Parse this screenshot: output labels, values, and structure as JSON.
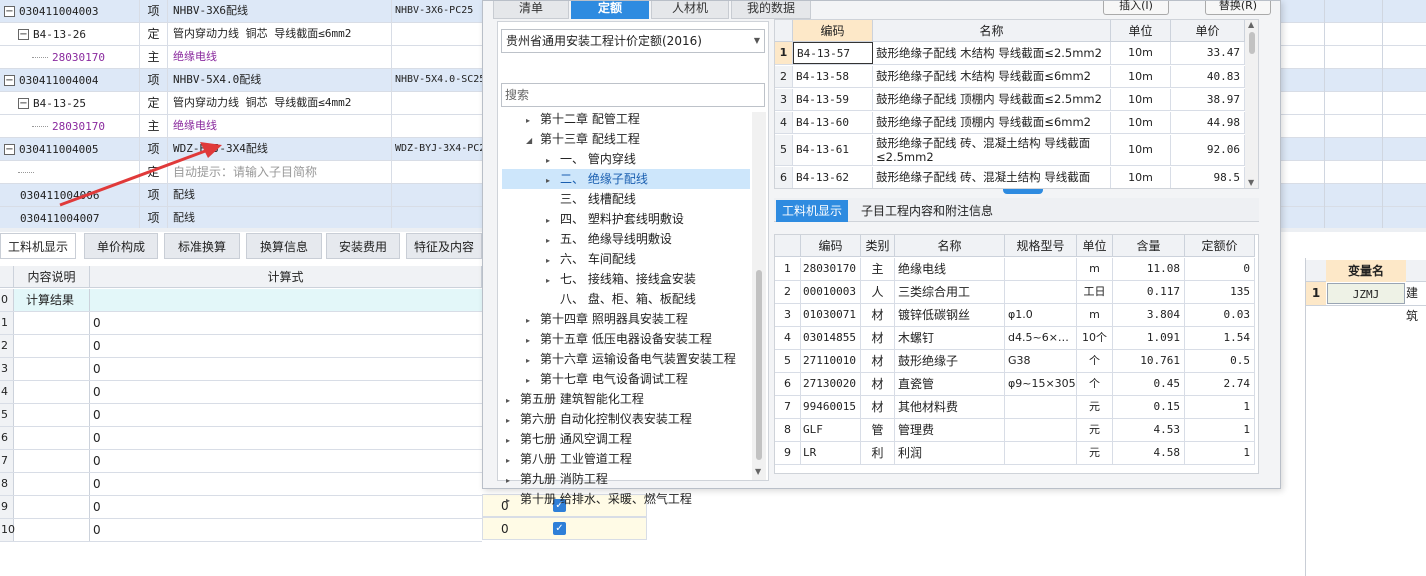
{
  "project_rows": [
    {
      "code": "030411004003",
      "type": "项",
      "name": "NHBV-3X6配线",
      "spec": "NHBV-3X6-PC25",
      "level": 0,
      "highlight": true,
      "tree": "⊟"
    },
    {
      "code": "B4-13-26",
      "type": "定",
      "name": "管内穿动力线 铜芯 导线截面≤6mm2",
      "spec": "",
      "level": 1,
      "highlight": false,
      "tree": "⊟"
    },
    {
      "code": "28030170",
      "type": "主",
      "name": "绝缘电线",
      "spec": "",
      "level": 2,
      "highlight": false,
      "tree": "",
      "purple": true
    },
    {
      "code": "030411004004",
      "type": "项",
      "name": "NHBV-5X4.0配线",
      "spec": "NHBV-5X4.0-SC25",
      "level": 0,
      "highlight": true,
      "tree": "⊟"
    },
    {
      "code": "B4-13-25",
      "type": "定",
      "name": "管内穿动力线 铜芯 导线截面≤4mm2",
      "spec": "",
      "level": 1,
      "highlight": false,
      "tree": "⊟"
    },
    {
      "code": "28030170",
      "type": "主",
      "name": "绝缘电线",
      "spec": "",
      "level": 2,
      "highlight": false,
      "tree": "",
      "purple": true
    },
    {
      "code": "030411004005",
      "type": "项",
      "name": "WDZ-BYJ-3X4配线",
      "spec": "WDZ-BYJ-3X4-PC2",
      "level": 0,
      "highlight": true,
      "tree": "⊟"
    },
    {
      "code": "",
      "type": "定",
      "name": "自动提示：请输入子目简称",
      "spec": "",
      "level": 1,
      "highlight": false,
      "tree": "",
      "gray": true
    },
    {
      "code": "030411004006",
      "type": "项",
      "name": "配线",
      "spec": "",
      "level": 0,
      "highlight": true,
      "tree": ""
    },
    {
      "code": "030411004007",
      "type": "项",
      "name": "配线",
      "spec": "",
      "level": 0,
      "highlight": true,
      "tree": ""
    }
  ],
  "bottom_tabs": [
    "工料机显示",
    "单价构成",
    "标准换算",
    "换算信息",
    "安装费用",
    "特征及内容"
  ],
  "calc_headers": {
    "desc": "内容说明",
    "formula": "计算式"
  },
  "calc_rows": [
    {
      "n": "0",
      "desc": "计算结果",
      "formula": ""
    },
    {
      "n": "1",
      "desc": "",
      "formula": "0"
    },
    {
      "n": "2",
      "desc": "",
      "formula": "0"
    },
    {
      "n": "3",
      "desc": "",
      "formula": "0"
    },
    {
      "n": "4",
      "desc": "",
      "formula": "0"
    },
    {
      "n": "5",
      "desc": "",
      "formula": "0"
    },
    {
      "n": "6",
      "desc": "",
      "formula": "0"
    },
    {
      "n": "7",
      "desc": "",
      "formula": "0"
    },
    {
      "n": "8",
      "desc": "",
      "formula": "0"
    },
    {
      "n": "9",
      "desc": "",
      "formula": "0"
    },
    {
      "n": "10",
      "desc": "",
      "formula": "0"
    }
  ],
  "extra_zero_values": [
    "0",
    "0"
  ],
  "dialog": {
    "tabs": [
      "清单",
      "定额",
      "人材机",
      "我的数据"
    ],
    "active_tab": 1,
    "insert_button": "插入(I)",
    "replace_button": "替换(R)",
    "quota_library": "贵州省通用安装工程计价定额(2016)",
    "search_placeholder": "搜索",
    "tree": [
      {
        "label": "第十二章  配管工程",
        "indent": 1,
        "tri": "▸"
      },
      {
        "label": "第十三章  配线工程",
        "indent": 1,
        "tri": "◢"
      },
      {
        "label": "一、  管内穿线",
        "indent": 2,
        "tri": "▸"
      },
      {
        "label": "二、  绝缘子配线",
        "indent": 2,
        "tri": "▸",
        "selected": true
      },
      {
        "label": "三、  线槽配线",
        "indent": 2,
        "tri": ""
      },
      {
        "label": "四、  塑料护套线明敷设",
        "indent": 2,
        "tri": "▸"
      },
      {
        "label": "五、  绝缘导线明敷设",
        "indent": 2,
        "tri": "▸"
      },
      {
        "label": "六、  车间配线",
        "indent": 2,
        "tri": "▸"
      },
      {
        "label": "七、  接线箱、接线盒安装",
        "indent": 2,
        "tri": "▸"
      },
      {
        "label": "八、  盘、柜、箱、板配线",
        "indent": 2,
        "tri": ""
      },
      {
        "label": "第十四章  照明器具安装工程",
        "indent": 1,
        "tri": "▸"
      },
      {
        "label": "第十五章  低压电器设备安装工程",
        "indent": 1,
        "tri": "▸"
      },
      {
        "label": "第十六章  运输设备电气装置安装工程",
        "indent": 1,
        "tri": "▸"
      },
      {
        "label": "第十七章  电气设备调试工程",
        "indent": 1,
        "tri": "▸"
      },
      {
        "label": "第五册  建筑智能化工程",
        "indent": 0,
        "tri": "▸"
      },
      {
        "label": "第六册  自动化控制仪表安装工程",
        "indent": 0,
        "tri": "▸"
      },
      {
        "label": "第七册  通风空调工程",
        "indent": 0,
        "tri": "▸"
      },
      {
        "label": "第八册  工业管道工程",
        "indent": 0,
        "tri": "▸"
      },
      {
        "label": "第九册  消防工程",
        "indent": 0,
        "tri": "▸"
      },
      {
        "label": "第十册  给排水、采暖、燃气工程",
        "indent": 0,
        "tri": "▸"
      }
    ],
    "quota_headers": {
      "code": "编码",
      "name": "名称",
      "unit": "单位",
      "price": "单价"
    },
    "quota_rows": [
      {
        "n": "1",
        "code": "B4-13-57",
        "name": "鼓形绝缘子配线 木结构 导线截面≤2.5mm2",
        "unit": "10m",
        "price": "33.47"
      },
      {
        "n": "2",
        "code": "B4-13-58",
        "name": "鼓形绝缘子配线 木结构 导线截面≤6mm2",
        "unit": "10m",
        "price": "40.83"
      },
      {
        "n": "3",
        "code": "B4-13-59",
        "name": "鼓形绝缘子配线 顶棚内 导线截面≤2.5mm2",
        "unit": "10m",
        "price": "38.97"
      },
      {
        "n": "4",
        "code": "B4-13-60",
        "name": "鼓形绝缘子配线 顶棚内 导线截面≤6mm2",
        "unit": "10m",
        "price": "44.98"
      },
      {
        "n": "5",
        "code": "B4-13-61",
        "name": "鼓形绝缘子配线 砖、混凝土结构 导线截面≤2.5mm2",
        "unit": "10m",
        "price": "92.06"
      },
      {
        "n": "6",
        "code": "B4-13-62",
        "name": "鼓形绝缘子配线 砖、混凝土结构 导线截面≤6mm2",
        "unit": "10m",
        "price": "98.5"
      }
    ],
    "lower_tabs": [
      "工料机显示",
      "子目工程内容和附注信息"
    ],
    "lmj_headers": {
      "code": "编码",
      "cat": "类别",
      "name": "名称",
      "spec": "规格型号",
      "unit": "单位",
      "qty": "含量",
      "price": "定额价"
    },
    "lmj_rows": [
      {
        "n": "1",
        "code": "28030170",
        "cat": "主",
        "name": "绝缘电线",
        "spec": "",
        "unit": "m",
        "qty": "11.08",
        "price": "0"
      },
      {
        "n": "2",
        "code": "00010003",
        "cat": "人",
        "name": "三类综合用工",
        "spec": "",
        "unit": "工日",
        "qty": "0.117",
        "price": "135"
      },
      {
        "n": "3",
        "code": "01030071",
        "cat": "材",
        "name": "镀锌低碳钢丝",
        "spec": "φ1.0",
        "unit": "m",
        "qty": "3.804",
        "price": "0.03"
      },
      {
        "n": "4",
        "code": "03014855",
        "cat": "材",
        "name": "木螺钉",
        "spec": "d4.5~6×…",
        "unit": "10个",
        "qty": "1.091",
        "price": "1.54"
      },
      {
        "n": "5",
        "code": "27110010",
        "cat": "材",
        "name": "鼓形绝缘子",
        "spec": "G38",
        "unit": "个",
        "qty": "10.761",
        "price": "0.5"
      },
      {
        "n": "6",
        "code": "27130020",
        "cat": "材",
        "name": "直瓷管",
        "spec": "φ9~15×305",
        "unit": "个",
        "qty": "0.45",
        "price": "2.74"
      },
      {
        "n": "7",
        "code": "99460015",
        "cat": "材",
        "name": "其他材料费",
        "spec": "",
        "unit": "元",
        "qty": "0.15",
        "price": "1"
      },
      {
        "n": "8",
        "code": "GLF",
        "cat": "管",
        "name": "管理费",
        "spec": "",
        "unit": "元",
        "qty": "4.53",
        "price": "1"
      },
      {
        "n": "9",
        "code": "LR",
        "cat": "利",
        "name": "利润",
        "spec": "",
        "unit": "元",
        "qty": "4.58",
        "price": "1"
      }
    ]
  },
  "variables": {
    "header": "变量名",
    "row_num": "1",
    "value": "JZMJ",
    "trailing": "建筑"
  },
  "colors": {
    "accent": "#2e8be0",
    "row_highlight": "#dde8f7",
    "arrow": "#e03a3a",
    "purple": "#8a2a9e"
  }
}
